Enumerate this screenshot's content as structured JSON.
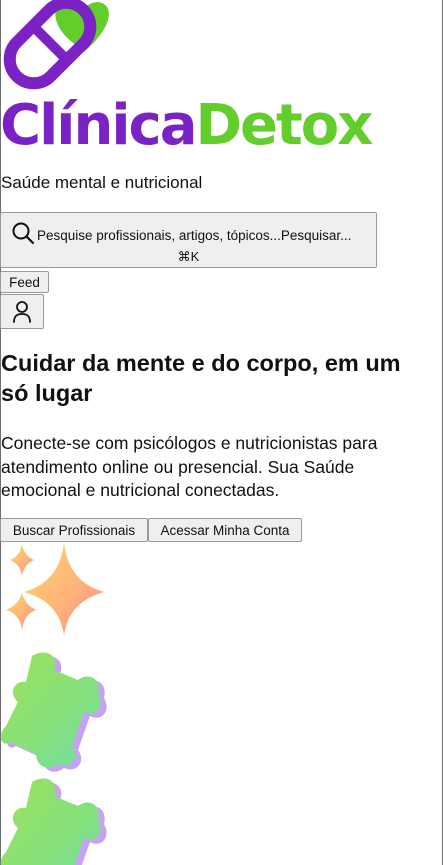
{
  "brand": {
    "name_part1": "Clínica",
    "name_part2": "Detox",
    "tagline": "Saúde mental e nutricional",
    "colors": {
      "purple": "#7b22c4",
      "green": "#62cd2b"
    }
  },
  "search": {
    "placeholder": "Pesquise profissionais, artigos, tópicos...",
    "action": "Pesquisar...",
    "shortcut": "⌘K",
    "icon": "search-icon"
  },
  "nav": {
    "feed_label": "Feed",
    "user_icon": "user-icon"
  },
  "hero": {
    "title": "Cuidar da mente e do corpo, em um só lugar",
    "description": "Conecte-se com psicólogos e nutricionistas para atendimento online ou presencial. Sua Saúde emocional e nutricional conectadas.",
    "cta_primary": "Buscar Profissionais",
    "cta_secondary": "Acessar Minha Conta"
  },
  "decorations": [
    "sparkles-icon",
    "puzzle-piece-icon",
    "puzzle-piece-icon"
  ]
}
